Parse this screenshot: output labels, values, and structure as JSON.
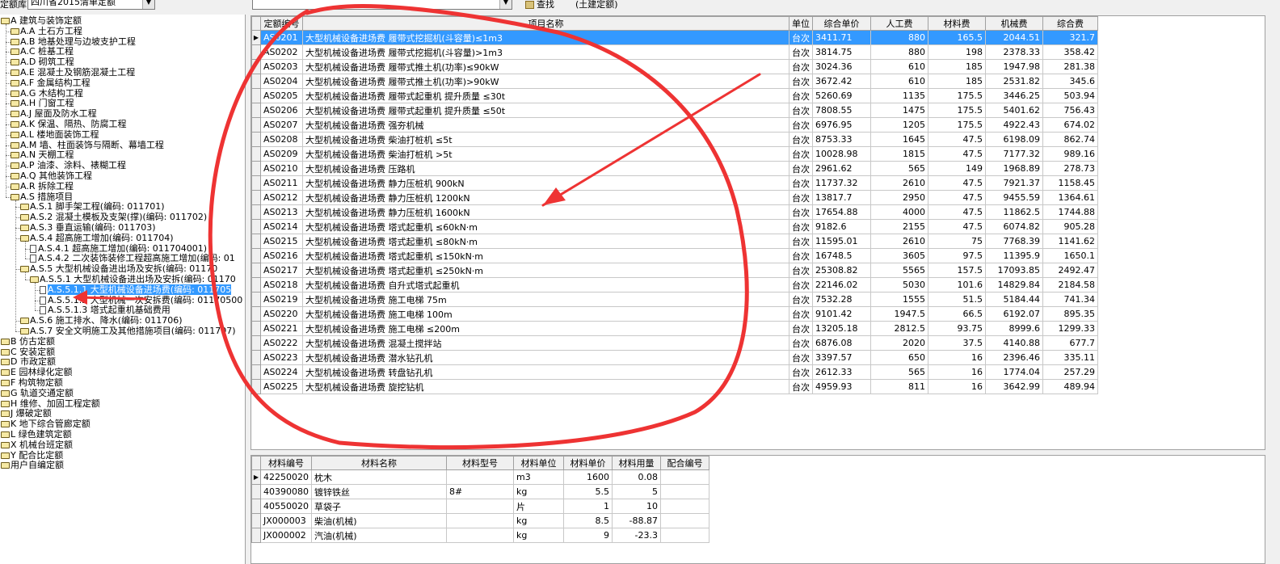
{
  "toolbar": {
    "library_label": "定额库",
    "library_value": "四川省2015清单定额",
    "category_value": "",
    "find_label": "查找",
    "mode_label": "(土建定额)"
  },
  "tree": {
    "nodes": [
      {
        "label": "A 建筑与装饰定额",
        "kind": "folder",
        "indent": 0,
        "selected": false
      },
      {
        "label": "A.A 土石方工程",
        "kind": "folder",
        "indent": 1,
        "selected": false
      },
      {
        "label": "A.B 地基处理与边坡支护工程",
        "kind": "folder",
        "indent": 1,
        "selected": false
      },
      {
        "label": "A.C 桩基工程",
        "kind": "folder",
        "indent": 1,
        "selected": false
      },
      {
        "label": "A.D 砌筑工程",
        "kind": "folder",
        "indent": 1,
        "selected": false
      },
      {
        "label": "A.E 混凝土及钢筋混凝土工程",
        "kind": "folder",
        "indent": 1,
        "selected": false
      },
      {
        "label": "A.F 金属结构工程",
        "kind": "folder",
        "indent": 1,
        "selected": false
      },
      {
        "label": "A.G 木结构工程",
        "kind": "folder",
        "indent": 1,
        "selected": false
      },
      {
        "label": "A.H 门窗工程",
        "kind": "folder",
        "indent": 1,
        "selected": false
      },
      {
        "label": "A.J 屋面及防水工程",
        "kind": "folder",
        "indent": 1,
        "selected": false
      },
      {
        "label": "A.K 保温、隔热、防腐工程",
        "kind": "folder",
        "indent": 1,
        "selected": false
      },
      {
        "label": "A.L 楼地面装饰工程",
        "kind": "folder",
        "indent": 1,
        "selected": false
      },
      {
        "label": "A.M 墙、柱面装饰与隔断、幕墙工程",
        "kind": "folder",
        "indent": 1,
        "selected": false
      },
      {
        "label": "A.N 天棚工程",
        "kind": "folder",
        "indent": 1,
        "selected": false
      },
      {
        "label": "A.P 油漆、涂料、裱糊工程",
        "kind": "folder",
        "indent": 1,
        "selected": false
      },
      {
        "label": "A.Q 其他装饰工程",
        "kind": "folder",
        "indent": 1,
        "selected": false
      },
      {
        "label": "A.R 拆除工程",
        "kind": "folder",
        "indent": 1,
        "selected": false
      },
      {
        "label": "A.S 措施项目",
        "kind": "folder",
        "indent": 1,
        "selected": false
      },
      {
        "label": "A.S.1 脚手架工程(编码: 011701)",
        "kind": "folder",
        "indent": 2,
        "selected": false
      },
      {
        "label": "A.S.2 混凝土模板及支架(撑)(编码: 011702)",
        "kind": "folder",
        "indent": 2,
        "selected": false
      },
      {
        "label": "A.S.3 垂直运输(编码: 011703)",
        "kind": "folder",
        "indent": 2,
        "selected": false
      },
      {
        "label": "A.S.4 超高施工增加(编码: 011704)",
        "kind": "folder",
        "indent": 2,
        "selected": false
      },
      {
        "label": "A.S.4.1 超高施工增加(编码: 011704001)",
        "kind": "doc",
        "indent": 3,
        "selected": false
      },
      {
        "label": "A.S.4.2 二次装饰装修工程超高施工增加(编码: 01",
        "kind": "doc",
        "indent": 3,
        "selected": false
      },
      {
        "label": "A.S.5 大型机械设备进出场及安拆(编码: 01170",
        "kind": "folder",
        "indent": 2,
        "selected": false
      },
      {
        "label": "A.S.5.1 大型机械设备进出场及安拆(编码: 01170",
        "kind": "folder",
        "indent": 3,
        "selected": false
      },
      {
        "label": "A.S.5.1.1 大型机械设备进场费(编码: 011705",
        "kind": "doc",
        "indent": 4,
        "selected": true
      },
      {
        "label": "A.S.5.1.2 大型机械一次安拆费(编码: 01170500",
        "kind": "doc",
        "indent": 4,
        "selected": false
      },
      {
        "label": "A.S.5.1.3 塔式起重机基础费用",
        "kind": "doc",
        "indent": 4,
        "selected": false
      },
      {
        "label": "A.S.6 施工排水、降水(编码: 011706)",
        "kind": "folder",
        "indent": 2,
        "selected": false
      },
      {
        "label": "A.S.7 安全文明施工及其他措施项目(编码: 011707)",
        "kind": "folder",
        "indent": 2,
        "selected": false
      },
      {
        "label": "B 仿古定额",
        "kind": "folder",
        "indent": 0,
        "selected": false
      },
      {
        "label": "C 安装定额",
        "kind": "folder",
        "indent": 0,
        "selected": false
      },
      {
        "label": "D 市政定额",
        "kind": "folder",
        "indent": 0,
        "selected": false
      },
      {
        "label": "E 园林绿化定额",
        "kind": "folder",
        "indent": 0,
        "selected": false
      },
      {
        "label": "F 构筑物定额",
        "kind": "folder",
        "indent": 0,
        "selected": false
      },
      {
        "label": "G 轨道交通定额",
        "kind": "folder",
        "indent": 0,
        "selected": false
      },
      {
        "label": "H 维修、加固工程定额",
        "kind": "folder",
        "indent": 0,
        "selected": false
      },
      {
        "label": "J 爆破定额",
        "kind": "folder",
        "indent": 0,
        "selected": false
      },
      {
        "label": "K 地下综合管廊定额",
        "kind": "folder",
        "indent": 0,
        "selected": false
      },
      {
        "label": "L 绿色建筑定额",
        "kind": "folder",
        "indent": 0,
        "selected": false
      },
      {
        "label": "X 机械台班定额",
        "kind": "folder",
        "indent": 0,
        "selected": false
      },
      {
        "label": "Y 配合比定额",
        "kind": "folder",
        "indent": 0,
        "selected": false
      },
      {
        "label": "用户自编定额",
        "kind": "folder",
        "indent": 0,
        "selected": false
      }
    ]
  },
  "quota_table": {
    "columns": [
      "定额编号",
      "项目名称",
      "单位",
      "综合单价",
      "人工费",
      "材料费",
      "机械费",
      "综合费"
    ],
    "rows": [
      [
        "AS0201",
        "大型机械设备进场费 履带式挖掘机(斗容量)≤1m3",
        "台次",
        "3411.71",
        "880",
        "165.5",
        "2044.51",
        "321.7"
      ],
      [
        "AS0202",
        "大型机械设备进场费 履带式挖掘机(斗容量)>1m3",
        "台次",
        "3814.75",
        "880",
        "198",
        "2378.33",
        "358.42"
      ],
      [
        "AS0203",
        "大型机械设备进场费 履带式推土机(功率)≤90kW",
        "台次",
        "3024.36",
        "610",
        "185",
        "1947.98",
        "281.38"
      ],
      [
        "AS0204",
        "大型机械设备进场费 履带式推土机(功率)>90kW",
        "台次",
        "3672.42",
        "610",
        "185",
        "2531.82",
        "345.6"
      ],
      [
        "AS0205",
        "大型机械设备进场费 履带式起重机 提升质量 ≤30t",
        "台次",
        "5260.69",
        "1135",
        "175.5",
        "3446.25",
        "503.94"
      ],
      [
        "AS0206",
        "大型机械设备进场费 履带式起重机 提升质量 ≤50t",
        "台次",
        "7808.55",
        "1475",
        "175.5",
        "5401.62",
        "756.43"
      ],
      [
        "AS0207",
        "大型机械设备进场费 强夯机械",
        "台次",
        "6976.95",
        "1205",
        "175.5",
        "4922.43",
        "674.02"
      ],
      [
        "AS0208",
        "大型机械设备进场费 柴油打桩机 ≤5t",
        "台次",
        "8753.33",
        "1645",
        "47.5",
        "6198.09",
        "862.74"
      ],
      [
        "AS0209",
        "大型机械设备进场费 柴油打桩机 >5t",
        "台次",
        "10028.98",
        "1815",
        "47.5",
        "7177.32",
        "989.16"
      ],
      [
        "AS0210",
        "大型机械设备进场费 压路机",
        "台次",
        "2961.62",
        "565",
        "149",
        "1968.89",
        "278.73"
      ],
      [
        "AS0211",
        "大型机械设备进场费 静力压桩机 900kN",
        "台次",
        "11737.32",
        "2610",
        "47.5",
        "7921.37",
        "1158.45"
      ],
      [
        "AS0212",
        "大型机械设备进场费 静力压桩机 1200kN",
        "台次",
        "13817.7",
        "2950",
        "47.5",
        "9455.59",
        "1364.61"
      ],
      [
        "AS0213",
        "大型机械设备进场费 静力压桩机 1600kN",
        "台次",
        "17654.88",
        "4000",
        "47.5",
        "11862.5",
        "1744.88"
      ],
      [
        "AS0214",
        "大型机械设备进场费 塔式起重机 ≤60kN·m",
        "台次",
        "9182.6",
        "2155",
        "47.5",
        "6074.82",
        "905.28"
      ],
      [
        "AS0215",
        "大型机械设备进场费 塔式起重机 ≤80kN·m",
        "台次",
        "11595.01",
        "2610",
        "75",
        "7768.39",
        "1141.62"
      ],
      [
        "AS0216",
        "大型机械设备进场费 塔式起重机 ≤150kN·m",
        "台次",
        "16748.5",
        "3605",
        "97.5",
        "11395.9",
        "1650.1"
      ],
      [
        "AS0217",
        "大型机械设备进场费 塔式起重机 ≤250kN·m",
        "台次",
        "25308.82",
        "5565",
        "157.5",
        "17093.85",
        "2492.47"
      ],
      [
        "AS0218",
        "大型机械设备进场费 自升式塔式起重机",
        "台次",
        "22146.02",
        "5030",
        "101.6",
        "14829.84",
        "2184.58"
      ],
      [
        "AS0219",
        "大型机械设备进场费 施工电梯 75m",
        "台次",
        "7532.28",
        "1555",
        "51.5",
        "5184.44",
        "741.34"
      ],
      [
        "AS0220",
        "大型机械设备进场费 施工电梯 100m",
        "台次",
        "9101.42",
        "1947.5",
        "66.5",
        "6192.07",
        "895.35"
      ],
      [
        "AS0221",
        "大型机械设备进场费 施工电梯 ≤200m",
        "台次",
        "13205.18",
        "2812.5",
        "93.75",
        "8999.6",
        "1299.33"
      ],
      [
        "AS0222",
        "大型机械设备进场费 混凝土搅拌站",
        "台次",
        "6876.08",
        "2020",
        "37.5",
        "4140.88",
        "677.7"
      ],
      [
        "AS0223",
        "大型机械设备进场费 潜水钻孔机",
        "台次",
        "3397.57",
        "650",
        "16",
        "2396.46",
        "335.11"
      ],
      [
        "AS0224",
        "大型机械设备进场费 转盘钻孔机",
        "台次",
        "2612.33",
        "565",
        "16",
        "1774.04",
        "257.29"
      ],
      [
        "AS0225",
        "大型机械设备进场费 旋挖钻机",
        "台次",
        "4959.93",
        "811",
        "16",
        "3642.99",
        "489.94"
      ]
    ],
    "selected_row": 0
  },
  "material_table": {
    "columns": [
      "材料编号",
      "材料名称",
      "材料型号",
      "材料单位",
      "材料单价",
      "材料用量",
      "配合编号"
    ],
    "rows": [
      [
        "42250020",
        "枕木",
        "",
        "m3",
        "1600",
        "0.08",
        ""
      ],
      [
        "40390080",
        "镀锌铁丝",
        "8#",
        "kg",
        "5.5",
        "5",
        ""
      ],
      [
        "40550020",
        "草袋子",
        "",
        "片",
        "1",
        "10",
        ""
      ],
      [
        "JX000003",
        "柴油(机械)",
        "",
        "kg",
        "8.5",
        "-88.87",
        ""
      ],
      [
        "JX000002",
        "汽油(机械)",
        "",
        "kg",
        "9",
        "-23.3",
        ""
      ]
    ],
    "current_row": 0
  },
  "colors": {
    "selection": "#3399ff",
    "annotation": "#ee3333"
  }
}
